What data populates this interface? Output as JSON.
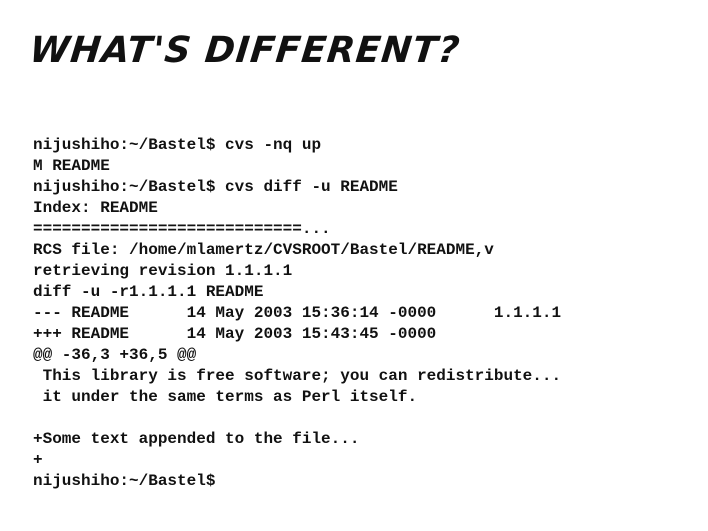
{
  "slide": {
    "title": "WHAT'S DIFFERENT?",
    "terminal_lines": [
      "nijushiho:~/Bastel$ cvs -nq up",
      "M README",
      "nijushiho:~/Bastel$ cvs diff -u README",
      "Index: README",
      "============================...",
      "RCS file: /home/mlamertz/CVSROOT/Bastel/README,v",
      "retrieving revision 1.1.1.1",
      "diff -u -r1.1.1.1 README",
      "--- README      14 May 2003 15:36:14 -0000      1.1.1.1",
      "+++ README      14 May 2003 15:43:45 -0000",
      "@@ -36,3 +36,5 @@",
      " This library is free software; you can redistribute...",
      " it under the same terms as Perl itself.",
      "",
      "+Some text appended to the file...",
      "+",
      "nijushiho:~/Bastel$"
    ]
  }
}
